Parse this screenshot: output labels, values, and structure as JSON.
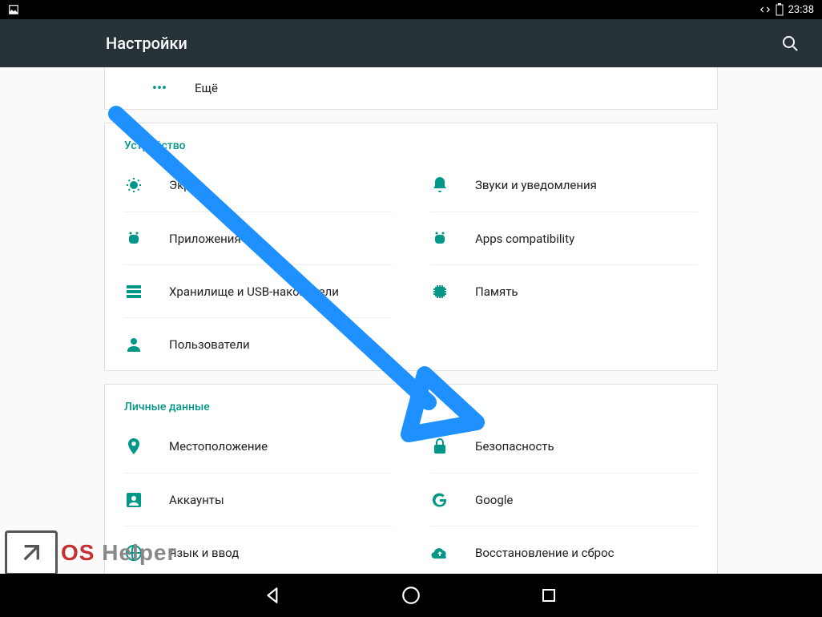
{
  "status": {
    "time": "23:38"
  },
  "appbar": {
    "title": "Настройки"
  },
  "more": {
    "label": "Ещё"
  },
  "sections": {
    "device": {
      "title": "Устройство",
      "left": [
        {
          "label": "Экран"
        },
        {
          "label": "Приложения"
        },
        {
          "label": "Хранилище и USB-накопители"
        },
        {
          "label": "Пользователи"
        }
      ],
      "right": [
        {
          "label": "Звуки и уведомления"
        },
        {
          "label": "Apps compatibility"
        },
        {
          "label": "Память"
        }
      ]
    },
    "personal": {
      "title": "Личные данные",
      "left": [
        {
          "label": "Местоположение"
        },
        {
          "label": "Аккаунты"
        },
        {
          "label": "Язык и ввод"
        }
      ],
      "right": [
        {
          "label": "Безопасность"
        },
        {
          "label": "Google"
        },
        {
          "label": "Восстановление и сброс"
        }
      ]
    }
  },
  "watermark": {
    "os": "OS",
    "helper": " Helper"
  },
  "colors": {
    "accent": "#009688",
    "arrow": "#1e90ff"
  }
}
